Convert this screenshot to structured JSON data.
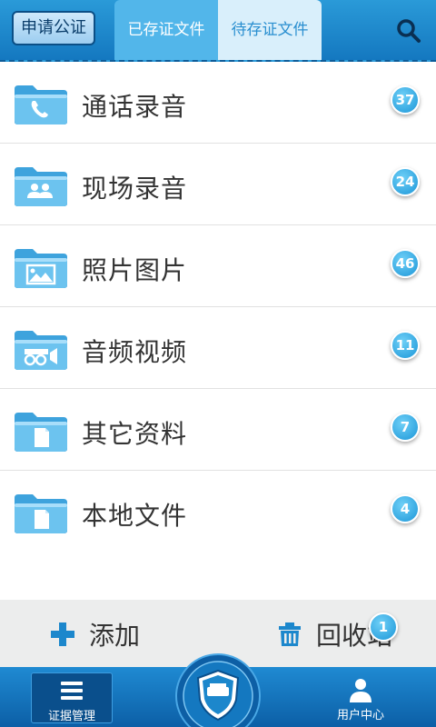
{
  "header": {
    "apply_button": "申请公证",
    "tabs": [
      {
        "label": "已存证文件",
        "active": true
      },
      {
        "label": "待存证文件",
        "active": false
      }
    ],
    "search_icon": "search-icon"
  },
  "folders": [
    {
      "label": "通话录音",
      "count": "37",
      "icon": "phone-folder-icon"
    },
    {
      "label": "现场录音",
      "count": "24",
      "icon": "people-folder-icon"
    },
    {
      "label": "照片图片",
      "count": "46",
      "icon": "image-folder-icon"
    },
    {
      "label": "音频视频",
      "count": "11",
      "icon": "video-camera-folder-icon"
    },
    {
      "label": "其它资料",
      "count": "7",
      "icon": "document-folder-icon"
    },
    {
      "label": "本地文件",
      "count": "4",
      "icon": "document-folder-icon"
    }
  ],
  "actions": {
    "add_label": "添加",
    "recycle_label": "回收站",
    "recycle_count": "1"
  },
  "bottom_nav": {
    "evidence_label": "证据管理",
    "user_label": "用户中心"
  },
  "colors": {
    "header_blue": "#1c87cc",
    "active_tab": "#52b6ea",
    "inactive_tab": "#d9effb",
    "badge_blue": "#1c96d8",
    "folder_blue": "#5bb8ec",
    "nav_blue": "#0c5fa6"
  }
}
